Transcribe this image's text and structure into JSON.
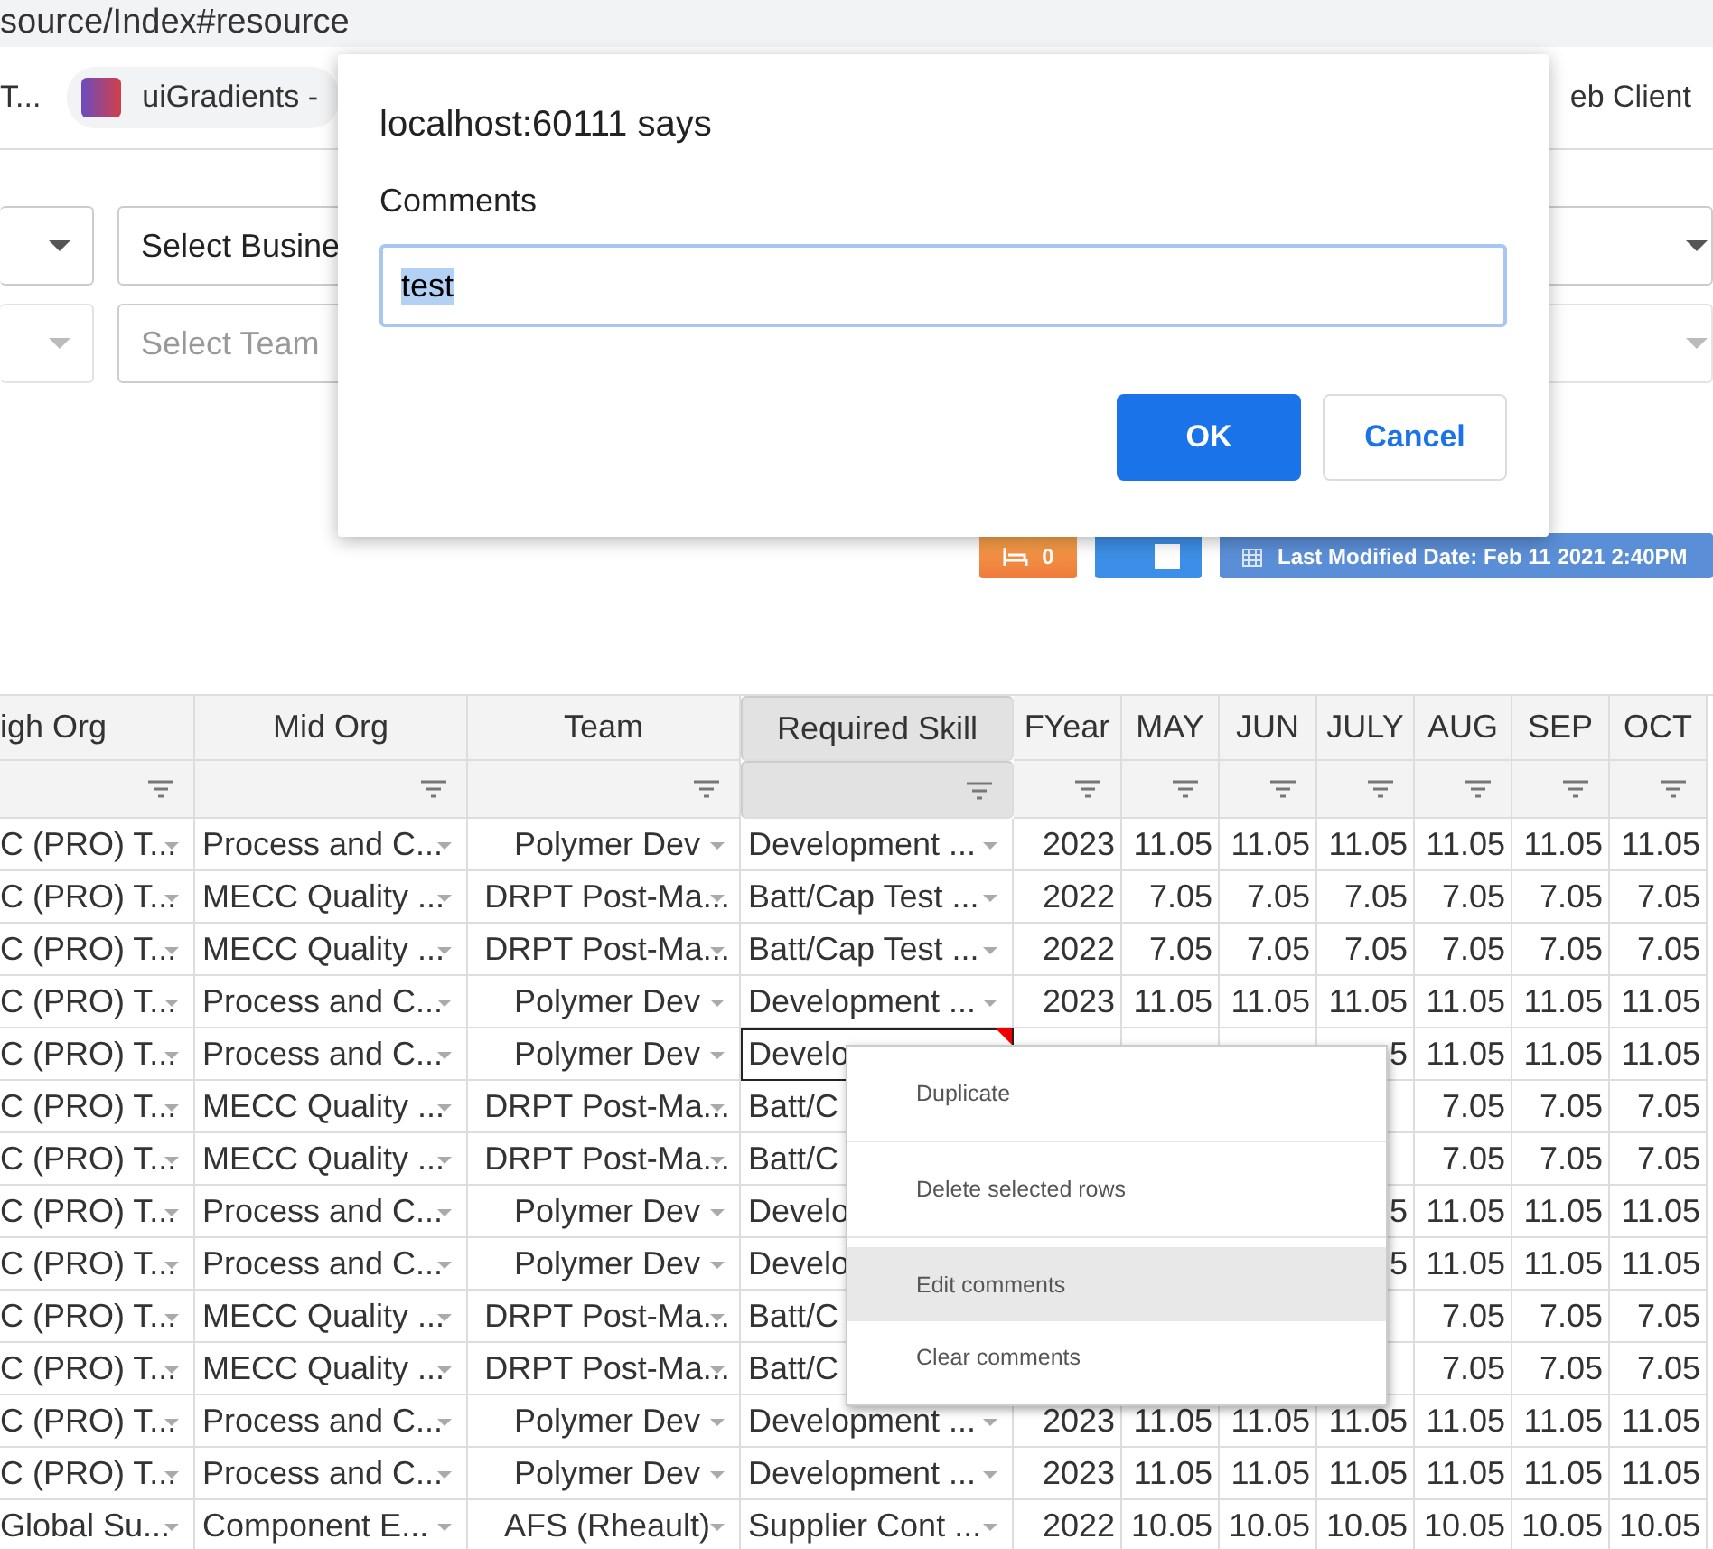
{
  "browser": {
    "url": "source/Index#resource",
    "bookmarks": [
      {
        "label": "T...",
        "kind": "text"
      },
      {
        "label": "uiGradients -",
        "kind": "favicon"
      },
      {
        "label": "eb Client",
        "kind": "text"
      }
    ]
  },
  "filter_rows": [
    {
      "fields": [
        {
          "kind": "caret",
          "disabled": false
        },
        {
          "kind": "select",
          "value": "Select Busine"
        },
        {
          "kind": "caret",
          "disabled": false
        }
      ]
    },
    {
      "fields": [
        {
          "kind": "caret",
          "disabled": true
        },
        {
          "kind": "select",
          "placeholder": "Select Team"
        },
        {
          "kind": "caret",
          "disabled": true
        }
      ]
    }
  ],
  "toolbar": {
    "count": "0",
    "toggle_on": true,
    "modified": "Last Modified Date: Feb 11 2021 2:40PM"
  },
  "dialog": {
    "title": "localhost:60111 says",
    "label": "Comments",
    "value": "test",
    "value_selected": true,
    "buttons": [
      {
        "label": "OK",
        "kind": "primary"
      },
      {
        "label": "Cancel",
        "kind": "secondary"
      }
    ]
  },
  "table": {
    "columns": [
      {
        "label": "igh Org",
        "kind": "dropdown",
        "selected": false
      },
      {
        "label": "Mid Org",
        "kind": "dropdown",
        "selected": false
      },
      {
        "label": "Team",
        "kind": "dropdown",
        "selected": false
      },
      {
        "label": "Required Skill",
        "kind": "dropdown",
        "selected": true
      },
      {
        "label": "FYear",
        "kind": "number",
        "selected": false
      },
      {
        "label": "MAY",
        "kind": "number",
        "selected": false
      },
      {
        "label": "JUN",
        "kind": "number",
        "selected": false
      },
      {
        "label": "JULY",
        "kind": "number",
        "selected": false
      },
      {
        "label": "AUG",
        "kind": "number",
        "selected": false
      },
      {
        "label": "SEP",
        "kind": "number",
        "selected": false
      },
      {
        "label": "OCT",
        "kind": "number",
        "selected": false
      }
    ],
    "rows": [
      {
        "focused": false,
        "has_comment": false,
        "cells": [
          "C (PRO) T...",
          "Process and C...",
          "Polymer Dev",
          "Development ...",
          "2023",
          "11.05",
          "11.05",
          "11.05",
          "11.05",
          "11.05",
          "11.05"
        ]
      },
      {
        "focused": false,
        "has_comment": false,
        "cells": [
          "C (PRO) T...",
          "MECC Quality ...",
          "DRPT Post-Ma...",
          "Batt/Cap Test ...",
          "2022",
          "7.05",
          "7.05",
          "7.05",
          "7.05",
          "7.05",
          "7.05"
        ]
      },
      {
        "focused": false,
        "has_comment": false,
        "cells": [
          "C (PRO) T...",
          "MECC Quality ...",
          "DRPT Post-Ma...",
          "Batt/Cap Test ...",
          "2022",
          "7.05",
          "7.05",
          "7.05",
          "7.05",
          "7.05",
          "7.05"
        ]
      },
      {
        "focused": false,
        "has_comment": false,
        "cells": [
          "C (PRO) T...",
          "Process and C...",
          "Polymer Dev",
          "Development ...",
          "2023",
          "11.05",
          "11.05",
          "11.05",
          "11.05",
          "11.05",
          "11.05"
        ]
      },
      {
        "focused": true,
        "has_comment": true,
        "cells": [
          "C (PRO) T...",
          "Process and C...",
          "Polymer Dev",
          "Develo",
          null,
          null,
          null,
          "5",
          "11.05",
          "11.05",
          "11.05"
        ]
      },
      {
        "focused": false,
        "has_comment": false,
        "cells": [
          "C (PRO) T...",
          "MECC Quality ...",
          "DRPT Post-Ma...",
          "Batt/C",
          null,
          null,
          null,
          null,
          "7.05",
          "7.05",
          "7.05"
        ]
      },
      {
        "focused": false,
        "has_comment": false,
        "cells": [
          "C (PRO) T...",
          "MECC Quality ...",
          "DRPT Post-Ma...",
          "Batt/C",
          null,
          null,
          null,
          null,
          "7.05",
          "7.05",
          "7.05"
        ]
      },
      {
        "focused": false,
        "has_comment": false,
        "cells": [
          "C (PRO) T...",
          "Process and C...",
          "Polymer Dev",
          "Develo",
          null,
          null,
          null,
          "5",
          "11.05",
          "11.05",
          "11.05"
        ]
      },
      {
        "focused": false,
        "has_comment": false,
        "cells": [
          "C (PRO) T...",
          "Process and C...",
          "Polymer Dev",
          "Develo",
          null,
          null,
          null,
          "5",
          "11.05",
          "11.05",
          "11.05"
        ]
      },
      {
        "focused": false,
        "has_comment": false,
        "cells": [
          "C (PRO) T...",
          "MECC Quality ...",
          "DRPT Post-Ma...",
          "Batt/C",
          null,
          null,
          null,
          null,
          "7.05",
          "7.05",
          "7.05"
        ]
      },
      {
        "focused": false,
        "has_comment": false,
        "cells": [
          "C (PRO) T...",
          "MECC Quality ...",
          "DRPT Post-Ma...",
          "Batt/C",
          null,
          null,
          null,
          null,
          "7.05",
          "7.05",
          "7.05"
        ]
      },
      {
        "focused": false,
        "has_comment": false,
        "cells": [
          "C (PRO) T...",
          "Process and C...",
          "Polymer Dev",
          "Development ...",
          "2023",
          "11.05",
          "11.05",
          "11.05",
          "11.05",
          "11.05",
          "11.05"
        ]
      },
      {
        "focused": false,
        "has_comment": false,
        "cells": [
          "C (PRO) T...",
          "Process and C...",
          "Polymer Dev",
          "Development ...",
          "2023",
          "11.05",
          "11.05",
          "11.05",
          "11.05",
          "11.05",
          "11.05"
        ]
      },
      {
        "focused": false,
        "has_comment": false,
        "cells": [
          "Global Su...",
          "Component E...",
          "AFS (Rheault)",
          "Supplier Cont ...",
          "2022",
          "10.05",
          "10.05",
          "10.05",
          "10.05",
          "10.05",
          "10.05"
        ]
      }
    ]
  },
  "context_menu": {
    "items": [
      {
        "label": "Duplicate",
        "selected": false
      },
      {
        "label": "Delete selected rows",
        "selected": false
      },
      {
        "label": "Edit comments",
        "selected": true
      },
      {
        "label": "Clear comments",
        "selected": false
      }
    ]
  }
}
